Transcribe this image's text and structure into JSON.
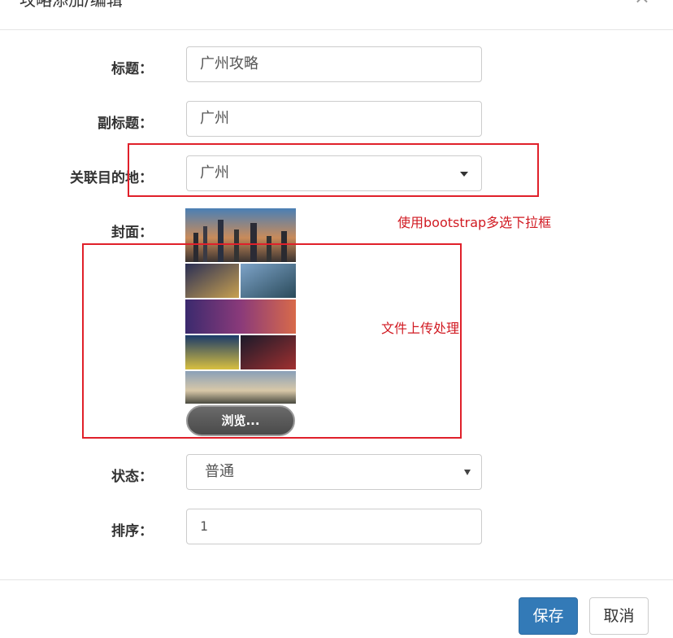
{
  "dialog": {
    "title": "攻略添加/编辑",
    "close_icon": "close-icon"
  },
  "form": {
    "title": {
      "label": "标题：",
      "value": "广州攻略"
    },
    "subtitle": {
      "label": "副标题：",
      "value": "广州"
    },
    "destination": {
      "label": "关联目的地：",
      "selected": "广州"
    },
    "cover": {
      "label": "封面：",
      "browse_label": "浏览..."
    },
    "status": {
      "label": "状态：",
      "selected": "普通"
    },
    "sort": {
      "label": "排序：",
      "value": "1"
    }
  },
  "annotations": {
    "multiselect_note": "使用bootstrap多选下拉框",
    "upload_note": "文件上传处理",
    "color": "#e0202a"
  },
  "footer": {
    "save_label": "保存",
    "cancel_label": "取消"
  },
  "colors": {
    "primary": "#337ab7",
    "annotation_red": "#d11a22"
  }
}
